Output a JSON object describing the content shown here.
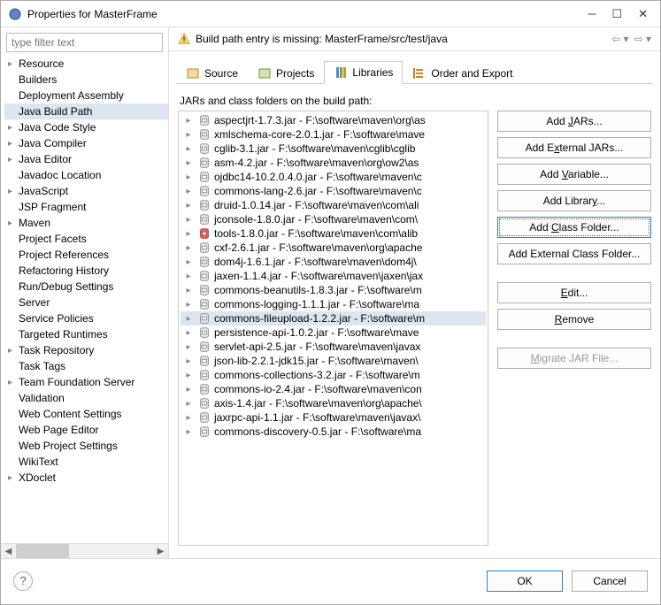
{
  "window": {
    "title": "Properties for MasterFrame",
    "filter_placeholder": "type filter text"
  },
  "banner": {
    "text": "Build path entry is missing: MasterFrame/src/test/java"
  },
  "left_tree": {
    "items": [
      {
        "label": "Resource",
        "arrow": true
      },
      {
        "label": "Builders"
      },
      {
        "label": "Deployment Assembly"
      },
      {
        "label": "Java Build Path",
        "selected": true
      },
      {
        "label": "Java Code Style",
        "arrow": true
      },
      {
        "label": "Java Compiler",
        "arrow": true
      },
      {
        "label": "Java Editor",
        "arrow": true
      },
      {
        "label": "Javadoc Location"
      },
      {
        "label": "JavaScript",
        "arrow": true
      },
      {
        "label": "JSP Fragment"
      },
      {
        "label": "Maven",
        "arrow": true
      },
      {
        "label": "Project Facets"
      },
      {
        "label": "Project References"
      },
      {
        "label": "Refactoring History"
      },
      {
        "label": "Run/Debug Settings"
      },
      {
        "label": "Server"
      },
      {
        "label": "Service Policies"
      },
      {
        "label": "Targeted Runtimes"
      },
      {
        "label": "Task Repository",
        "arrow": true
      },
      {
        "label": "Task Tags"
      },
      {
        "label": "Team Foundation Server",
        "arrow": true
      },
      {
        "label": "Validation"
      },
      {
        "label": "Web Content Settings"
      },
      {
        "label": "Web Page Editor"
      },
      {
        "label": "Web Project Settings"
      },
      {
        "label": "WikiText"
      },
      {
        "label": "XDoclet",
        "arrow": true
      }
    ]
  },
  "tabs": {
    "source": "Source",
    "projects": "Projects",
    "libraries": "Libraries",
    "order_export": "Order and Export"
  },
  "content_label": "JARs and class folders on the build path:",
  "jars": [
    {
      "label": "aspectjrt-1.7.3.jar - F:\\software\\maven\\org\\as"
    },
    {
      "label": "xmlschema-core-2.0.1.jar - F:\\software\\mave"
    },
    {
      "label": "cglib-3.1.jar - F:\\software\\maven\\cglib\\cglib"
    },
    {
      "label": "asm-4.2.jar - F:\\software\\maven\\org\\ow2\\as"
    },
    {
      "label": "ojdbc14-10.2.0.4.0.jar - F:\\software\\maven\\c"
    },
    {
      "label": "commons-lang-2.6.jar - F:\\software\\maven\\c"
    },
    {
      "label": "druid-1.0.14.jar - F:\\software\\maven\\com\\ali"
    },
    {
      "label": "jconsole-1.8.0.jar - F:\\software\\maven\\com\\"
    },
    {
      "label": "tools-1.8.0.jar - F:\\software\\maven\\com\\alib",
      "red": true
    },
    {
      "label": "cxf-2.6.1.jar - F:\\software\\maven\\org\\apache"
    },
    {
      "label": "dom4j-1.6.1.jar - F:\\software\\maven\\dom4j\\"
    },
    {
      "label": "jaxen-1.1.4.jar - F:\\software\\maven\\jaxen\\jax"
    },
    {
      "label": "commons-beanutils-1.8.3.jar - F:\\software\\m"
    },
    {
      "label": "commons-logging-1.1.1.jar - F:\\software\\ma"
    },
    {
      "label": "commons-fileupload-1.2.2.jar - F:\\software\\m",
      "highlighted": true
    },
    {
      "label": "persistence-api-1.0.2.jar - F:\\software\\mave"
    },
    {
      "label": "servlet-api-2.5.jar - F:\\software\\maven\\javax"
    },
    {
      "label": "json-lib-2.2.1-jdk15.jar - F:\\software\\maven\\"
    },
    {
      "label": "commons-collections-3.2.jar - F:\\software\\m"
    },
    {
      "label": "commons-io-2.4.jar - F:\\software\\maven\\con"
    },
    {
      "label": "axis-1.4.jar - F:\\software\\maven\\org\\apache\\"
    },
    {
      "label": "jaxrpc-api-1.1.jar - F:\\software\\maven\\javax\\"
    },
    {
      "label": "commons-discovery-0.5.jar - F:\\software\\ma"
    }
  ],
  "buttons": {
    "add_jars": "Add JARs...",
    "add_external_jars": "Add External JARs...",
    "add_variable": "Add Variable...",
    "add_library": "Add Library...",
    "add_class_folder": "Add Class Folder...",
    "add_external_class_folder": "Add External Class Folder...",
    "edit": "Edit...",
    "remove": "Remove",
    "migrate": "Migrate JAR File..."
  },
  "footer": {
    "ok": "OK",
    "cancel": "Cancel"
  }
}
